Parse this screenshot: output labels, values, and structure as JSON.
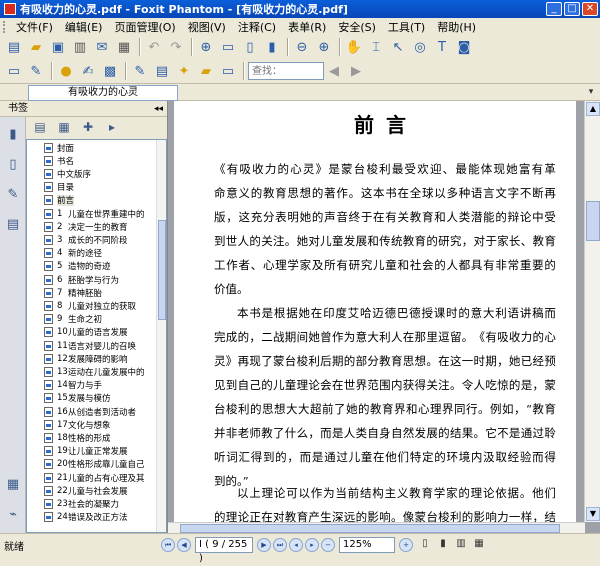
{
  "window": {
    "title": "有吸收力的心灵.pdf - Foxit Phantom - [有吸收力的心灵.pdf]",
    "min": "_",
    "max": "□",
    "close": "✕"
  },
  "menu": [
    "文件(F)",
    "编辑(E)",
    "页面管理(O)",
    "视图(V)",
    "注释(C)",
    "表单(R)",
    "安全(S)",
    "工具(T)",
    "帮助(H)"
  ],
  "toolbar": {
    "row1_icons": [
      "new-icon",
      "open-icon",
      "save-icon",
      "print-icon",
      "email-icon",
      "scan-icon",
      "undo-icon",
      "redo-icon",
      "zoom-in-icon",
      "page-icon",
      "fit-page-icon",
      "fit-width-icon",
      "zoom-out-icon",
      "zoom-plus-icon",
      "hand-icon",
      "select-text-icon",
      "select-icon",
      "binoculars-icon",
      "typewriter-icon",
      "snapshot-icon"
    ],
    "find_placeholder": "查找："
  },
  "tab": {
    "label": "有吸收力的心灵"
  },
  "sidebar": {
    "title": "书签",
    "collapse": "◂◂",
    "bookmarks": [
      {
        "num": "",
        "label": "封面"
      },
      {
        "num": "",
        "label": "书名"
      },
      {
        "num": "",
        "label": "中文版序"
      },
      {
        "num": "",
        "label": "目录"
      },
      {
        "num": "",
        "label": "前言"
      },
      {
        "num": "1",
        "label": "儿童在世界重建中的"
      },
      {
        "num": "2",
        "label": "决定一生的教育"
      },
      {
        "num": "3",
        "label": "成长的不同阶段"
      },
      {
        "num": "4",
        "label": "新的途径"
      },
      {
        "num": "5",
        "label": "造物的奇迹"
      },
      {
        "num": "6",
        "label": "胚胎学与行为"
      },
      {
        "num": "7",
        "label": "精神胚胎"
      },
      {
        "num": "8",
        "label": "儿童对独立的获取"
      },
      {
        "num": "9",
        "label": "生命之初"
      },
      {
        "num": "10",
        "label": "儿童的语言发展"
      },
      {
        "num": "11",
        "label": "语言对婴儿的召唤"
      },
      {
        "num": "12",
        "label": "发展障碍的影响"
      },
      {
        "num": "13",
        "label": "运动在儿童发展中的"
      },
      {
        "num": "14",
        "label": "智力与手"
      },
      {
        "num": "15",
        "label": "发展与模仿"
      },
      {
        "num": "16",
        "label": "从创造者到活动者"
      },
      {
        "num": "17",
        "label": "文化与想象"
      },
      {
        "num": "18",
        "label": "性格的形成"
      },
      {
        "num": "19",
        "label": "让儿童正常发展"
      },
      {
        "num": "20",
        "label": "性格形成靠儿童自己"
      },
      {
        "num": "21",
        "label": "儿童的占有心理及其"
      },
      {
        "num": "22",
        "label": "儿童与社会发展"
      },
      {
        "num": "23",
        "label": "社会的凝聚力"
      },
      {
        "num": "24",
        "label": "错误及改正方法"
      }
    ]
  },
  "page": {
    "title": "前言",
    "para1": [
      "《有吸收力的心灵》是蒙台梭利最受欢迎、最能体现她富有革",
      "命意义的教育思想的著作。这本书在全球以多种语言文字不断再",
      "版，这充分表明她的声音终于在有关教育和人类潜能的辩论中受",
      "到世人的关注。她对儿童发展和传统教育的研究，对于家长、教育",
      "工作者、心理学家及所有研究儿童和社会的人都具有非常重要的",
      "价值。"
    ],
    "para2": [
      "本书是根据她在印度艾哈迈德巴德授课时的意大利语讲稿而",
      "完成的，二战期间她曾作为意大利人在那里逗留。《有吸收力的心",
      "灵》再现了蒙台梭利后期的部分教育思想。在这一时期，她已经预",
      "见到自己的儿童理论会在世界范围内获得关注。令人吃惊的是，蒙",
      "台梭利的思想大大超前了她的教育界和心理界同行。例如，“教育",
      "并非老师教了什么，而是人类自身自然发展的结果。它不是通过聆",
      "听词汇得到的，而是通过儿童在他们特定的环境内汲取经验而得",
      "到的。”"
    ],
    "para3": [
      "以上理论可以作为当前结构主义教育学家的理论依据。他们",
      "的理论正在对教育产生深远的影响。像蒙台梭利的影响力一样，结"
    ]
  },
  "status": {
    "text": "就绪",
    "page_display": "I ( 9 / 255 )",
    "zoom": "125%"
  }
}
